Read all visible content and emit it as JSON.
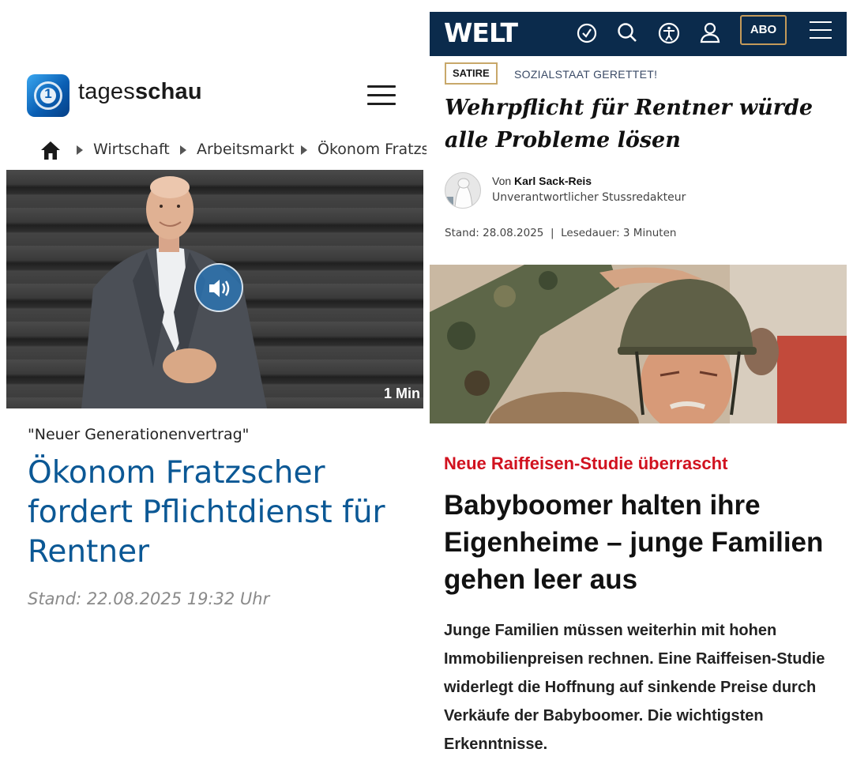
{
  "tagesschau": {
    "logo_number": "1",
    "brand_regular": "tages",
    "brand_bold": "schau",
    "breadcrumb": [
      "Wirtschaft",
      "Arbeitsmarkt",
      "Ökonom Fratzs"
    ],
    "video_duration": "1 Min",
    "kicker": "\"Neuer Generationenvertrag\"",
    "headline": "Ökonom Fratzscher fordert Pflichtdienst für Rentner",
    "stand": "Stand: 22.08.2025 19:32 Uhr",
    "icons": [
      "home-icon",
      "menu-icon",
      "speaker-icon"
    ]
  },
  "welt": {
    "logo": "WELT",
    "abo_label": "ABO",
    "header_icons": [
      "clock-icon",
      "search-icon",
      "accessibility-icon",
      "user-icon",
      "menu-icon"
    ],
    "badge": "SATIRE",
    "topic": "SOZIALSTAAT GERETTET!",
    "headline": "Wehrpflicht für Rentner würde alle Probleme lösen",
    "byline_prefix": "Von",
    "author": "Karl Sack-Reis",
    "author_role": "Unverantwortlicher Stussredakteur",
    "stand": "Stand: 28.08.2025",
    "reading_time": "Lesedauer: 3 Minuten"
  },
  "raiffeisen_article": {
    "kicker": "Neue Raiffeisen-Studie überrascht",
    "headline": "Babyboomer halten ihre Eigenheime – junge Familien gehen leer aus",
    "teaser": "Junge Familien müssen weiterhin mit hohen Immobilienpreisen rechnen. Eine Raiffeisen-Studie widerlegt die Hoffnung auf sinkende Preise durch Verkäufe der Babyboomer. Die wichtigsten Erkenntnisse."
  },
  "colors": {
    "tagesschau_blue": "#0b5895",
    "welt_navy": "#0b2b4c",
    "welt_gold": "#c49a5a",
    "kicker_red": "#d1121f"
  }
}
